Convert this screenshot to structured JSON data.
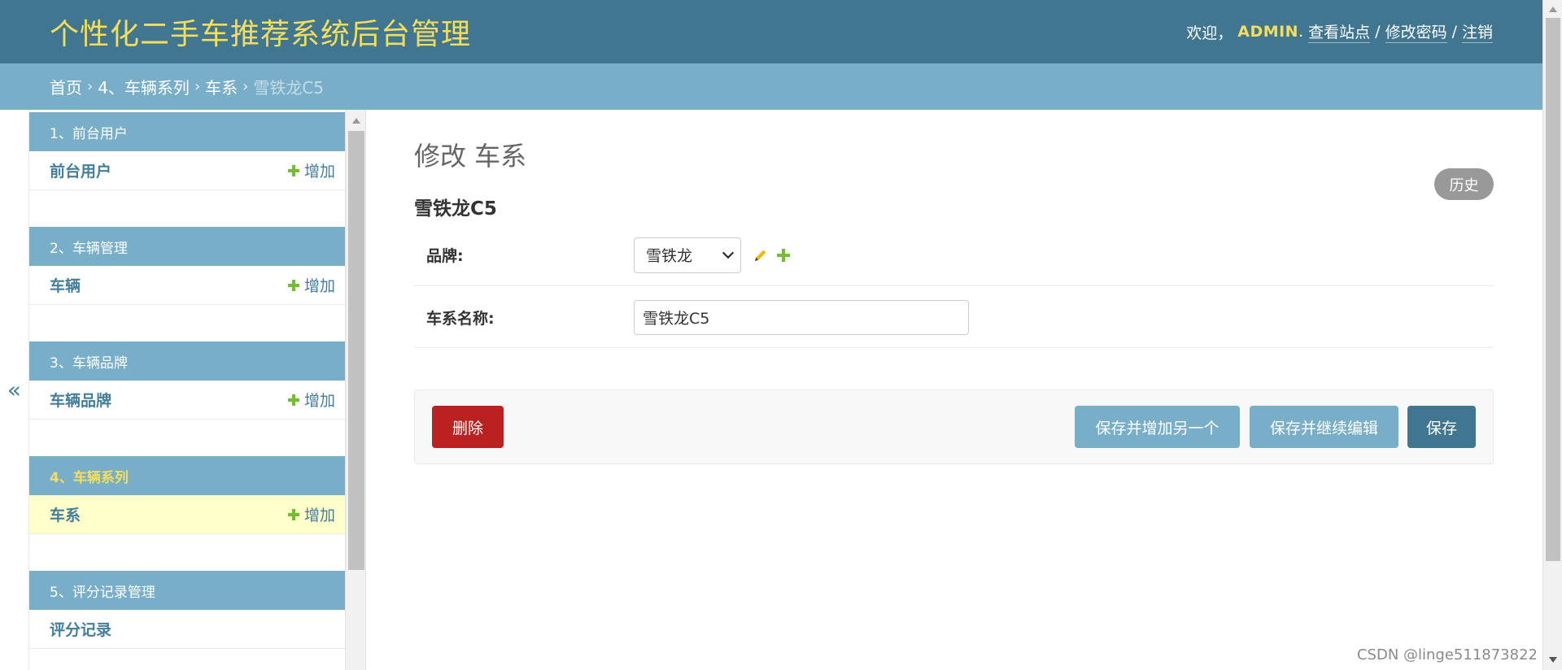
{
  "header": {
    "brand": "个性化二手车推荐系统后台管理",
    "welcome": "欢迎，",
    "username": "ADMIN",
    "period": ".",
    "view_site": "查看站点",
    "change_password": "修改密码",
    "logout": "注销",
    "separator": "/"
  },
  "breadcrumbs": {
    "home": "首页",
    "app": "4、车辆系列",
    "model": "车系",
    "current": "雪铁龙C5",
    "separator": "›"
  },
  "nav_toggle": "«",
  "sidebar": {
    "add_label": "增加",
    "modules": [
      {
        "caption": "1、前台用户",
        "rows": [
          {
            "label": "前台用户",
            "has_add": true
          }
        ]
      },
      {
        "caption": "2、车辆管理",
        "rows": [
          {
            "label": "车辆",
            "has_add": true
          }
        ]
      },
      {
        "caption": "3、车辆品牌",
        "rows": [
          {
            "label": "车辆品牌",
            "has_add": true
          }
        ]
      },
      {
        "caption": "4、车辆系列",
        "current": true,
        "rows": [
          {
            "label": "车系",
            "has_add": true,
            "current": true
          }
        ]
      },
      {
        "caption": "5、评分记录管理",
        "rows": [
          {
            "label": "评分记录",
            "has_add": false
          }
        ]
      }
    ]
  },
  "content": {
    "title": "修改 车系",
    "history": "历史",
    "object_name": "雪铁龙C5",
    "fields": {
      "brand_label": "品牌:",
      "brand_value": "雪铁龙",
      "series_label": "车系名称:",
      "series_value": "雪铁龙C5"
    },
    "actions": {
      "delete": "删除",
      "save_add_another": "保存并增加另一个",
      "save_continue": "保存并继续编辑",
      "save": "保存"
    }
  },
  "watermark": "CSDN @linge511873822",
  "icons": {
    "plus": "plus-icon",
    "pencil": "pencil-icon",
    "chevron": "chevron-down-icon"
  },
  "colors": {
    "header_bg": "#417690",
    "breadcrumb_bg": "#79aec8",
    "brand_yellow": "#f5dd5d",
    "add_green": "#70bf2b",
    "delete_red": "#ba2121",
    "current_row_bg": "#ffffcc"
  }
}
